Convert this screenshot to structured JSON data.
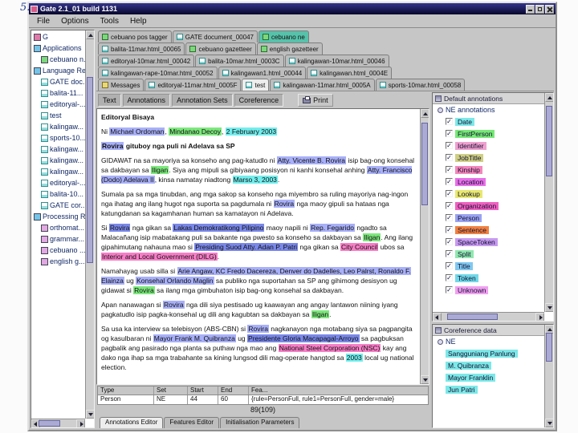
{
  "page": {
    "margin_note": "5."
  },
  "window": {
    "title": "Gate 2.1_01 build 1131",
    "menu": [
      "File",
      "Options",
      "Tools",
      "Help"
    ]
  },
  "resource_tree": {
    "items": [
      {
        "label": "G",
        "depth": 0,
        "icon": "gate"
      },
      {
        "label": "Applications",
        "depth": 0,
        "icon": "folder"
      },
      {
        "label": "cebuano n...",
        "depth": 1,
        "icon": "app"
      },
      {
        "label": "Language Re...",
        "depth": 0,
        "icon": "folder"
      },
      {
        "label": "GATE doc...",
        "depth": 1,
        "icon": "doc"
      },
      {
        "label": "balita-11...",
        "depth": 1,
        "icon": "doc"
      },
      {
        "label": "editoryal-...",
        "depth": 1,
        "icon": "doc"
      },
      {
        "label": "test",
        "depth": 1,
        "icon": "doc"
      },
      {
        "label": "kalingaw...",
        "depth": 1,
        "icon": "doc"
      },
      {
        "label": "sports-10...",
        "depth": 1,
        "icon": "doc"
      },
      {
        "label": "kalingaw...",
        "depth": 1,
        "icon": "doc"
      },
      {
        "label": "kalingaw...",
        "depth": 1,
        "icon": "doc"
      },
      {
        "label": "kalingaw...",
        "depth": 1,
        "icon": "doc"
      },
      {
        "label": "editoryal-...",
        "depth": 1,
        "icon": "doc"
      },
      {
        "label": "balita-10...",
        "depth": 1,
        "icon": "doc"
      },
      {
        "label": "GATE cor...",
        "depth": 1,
        "icon": "doc"
      },
      {
        "label": "Processing R...",
        "depth": 0,
        "icon": "folder"
      },
      {
        "label": "orthomat...",
        "depth": 1,
        "icon": "pr"
      },
      {
        "label": "grammar...",
        "depth": 1,
        "icon": "pr"
      },
      {
        "label": "cebuano ...",
        "depth": 1,
        "icon": "pr"
      },
      {
        "label": "english g...",
        "depth": 1,
        "icon": "pr"
      }
    ]
  },
  "tabs": {
    "rows": [
      [
        {
          "label": "cebuano pos tagger",
          "icon": "res",
          "state": "normal"
        },
        {
          "label": "GATE document_00047",
          "icon": "doc",
          "state": "normal"
        },
        {
          "label": "cebuano ne",
          "icon": "res",
          "state": "highlight"
        }
      ],
      [
        {
          "label": "balita-11mar.html_00065",
          "icon": "doc",
          "state": "normal"
        },
        {
          "label": "cebuano gazetteer",
          "icon": "res",
          "state": "normal"
        },
        {
          "label": "english gazetteer",
          "icon": "res",
          "state": "normal"
        }
      ],
      [
        {
          "label": "editoryal-10mar.html_00042",
          "icon": "doc",
          "state": "normal"
        },
        {
          "label": "balita-10mar.html_0003C",
          "icon": "doc",
          "state": "normal"
        },
        {
          "label": "kalingawan-10mar.html_00046",
          "icon": "doc",
          "state": "normal"
        }
      ],
      [
        {
          "label": "kalingawan-rape-10mar.html_00052",
          "icon": "doc",
          "state": "normal"
        },
        {
          "label": "kalingawan1.html_00044",
          "icon": "doc",
          "state": "normal"
        },
        {
          "label": "kalingawan.html_0004E",
          "icon": "doc",
          "state": "normal"
        }
      ],
      [
        {
          "label": "Messages",
          "icon": "msg",
          "state": "normal"
        },
        {
          "label": "editoryal-11mar.html_0005F",
          "icon": "doc",
          "state": "normal"
        },
        {
          "label": "test",
          "icon": "doc",
          "state": "selected"
        },
        {
          "label": "kalingawan-11mar.html_0005A",
          "icon": "doc",
          "state": "normal"
        },
        {
          "label": "sports-10mar.html_00058",
          "icon": "doc",
          "state": "normal"
        }
      ]
    ]
  },
  "toolbar": {
    "toggles": [
      {
        "label": "Text",
        "pressed": true
      },
      {
        "label": "Annotations",
        "pressed": true
      },
      {
        "label": "Annotation Sets",
        "pressed": true
      },
      {
        "label": "Coreference",
        "pressed": true
      }
    ],
    "print_label": "Print"
  },
  "highlight_colors": {
    "person": "#a8b0f8",
    "person_sel": "#7a88e8",
    "date": "#72eded",
    "firstperson": "#7ce87c",
    "org": "#f67ec6"
  },
  "document": {
    "paragraphs": [
      {
        "bold": true,
        "segments": [
          {
            "t": "Editoryal Bisaya"
          }
        ]
      },
      {
        "segments": [
          {
            "t": "Ni "
          },
          {
            "t": "Michael Ordoman",
            "hl": "person"
          },
          {
            "t": ", "
          },
          {
            "t": "Mindanao Decoy",
            "hl": "firstperson"
          },
          {
            "t": ", "
          },
          {
            "t": "2 February 2003",
            "hl": "date"
          }
        ]
      },
      {
        "bold": true,
        "segments": [
          {
            "t": "Rovira",
            "hl": "person"
          },
          {
            "t": " gituboy nga puli ni Adelava sa SP"
          }
        ]
      },
      {
        "segments": [
          {
            "t": "GIDAWAT na sa mayoriya sa konseho ang pag-katudlo ni "
          },
          {
            "t": "Atty. Vicente B. Rovira",
            "hl": "person"
          },
          {
            "t": " isip bag-ong konsehal sa dakbayan sa "
          },
          {
            "t": "Iligan",
            "hl": "firstperson"
          },
          {
            "t": ". Siya ang mipuli sa gibiyaang posisyon ni kanhi konsehal anhing "
          },
          {
            "t": "Atty. Francisco (Dodo) Adelava II",
            "hl": "person"
          },
          {
            "t": ", kinsa namatay niadtong "
          },
          {
            "t": "Marso 3, 2003",
            "hl": "date"
          },
          {
            "t": "."
          }
        ]
      },
      {
        "segments": [
          {
            "t": "Sumala pa sa mga tinubdan, ang mga sakop sa konseho nga miyembro sa ruling mayoriya nag-ingon nga ihatag ang ilang hugot nga suporta sa pagdumala ni "
          },
          {
            "t": "Rovira",
            "hl": "person"
          },
          {
            "t": " nga maoy gipuli sa hataas nga katungdanan sa kagamhanan human sa kamatayon ni Adelava."
          }
        ]
      },
      {
        "segments": [
          {
            "t": "Si "
          },
          {
            "t": "Rovira",
            "hl": "person_sel"
          },
          {
            "t": " nga gikan sa "
          },
          {
            "t": "Lakas Demokratikong Pilipino",
            "hl": "person_sel"
          },
          {
            "t": " maoy napili ni "
          },
          {
            "t": "Rep. Fegarido",
            "hl": "person"
          },
          {
            "t": " ngadto sa Malacañang isip mabatakang puli sa bakante nga pwesto sa konseho sa dakbayan sa "
          },
          {
            "t": "Iligan",
            "hl": "firstperson"
          },
          {
            "t": ". Ang ilang gipahimutang nahauna mao si "
          },
          {
            "t": "Presiding Suod Atty. Adan P. Patri",
            "hl": "person_sel"
          },
          {
            "t": " nga gikan sa "
          },
          {
            "t": "City Council",
            "hl": "org"
          },
          {
            "t": " ubos sa "
          },
          {
            "t": "Interior and Local Government (DILG)",
            "hl": "org"
          },
          {
            "t": "."
          }
        ]
      },
      {
        "segments": [
          {
            "t": "Namahayag usab silla si "
          },
          {
            "t": "Arie Angaw, KC Fredo Dacereza, Denver do Dadelles, Leo Palrst, Ronaldo F. Elainza",
            "hl": "person"
          },
          {
            "t": " ug "
          },
          {
            "t": "Konsehal Orlando Maglin",
            "hl": "person"
          },
          {
            "t": " sa publiko nga suportahan sa SP ang gihimong desisyon ug gidawat si "
          },
          {
            "t": "Rovira",
            "hl": "firstperson"
          },
          {
            "t": " sa ilang mga gimbuhaton isip bag-ong konsehal sa dakbayan."
          }
        ]
      },
      {
        "segments": [
          {
            "t": "Apan nanawagan si "
          },
          {
            "t": "Rovira",
            "hl": "person"
          },
          {
            "t": " nga dili siya pestisado ug kaawayan ang angay lantawon niining iyang pagkatudlo isip pagka-konsehal ug dili ang kagubtan sa dakbayan sa "
          },
          {
            "t": "Iligan",
            "hl": "firstperson"
          },
          {
            "t": "."
          }
        ]
      },
      {
        "segments": [
          {
            "t": "Sa usa ka interview sa telebisyon (ABS-CBN) si "
          },
          {
            "t": "Rovira",
            "hl": "person"
          },
          {
            "t": " nagkanayon nga motabang siya sa pagpangita og kasulbaran ni "
          },
          {
            "t": "Mayor Frank M. Quibranza",
            "hl": "person"
          },
          {
            "t": " ug "
          },
          {
            "t": "Presidente Gloria Macapagal-Arroyo",
            "hl": "person_sel"
          },
          {
            "t": " sa pagbuksan pagbalik ang pasirado nga planta sa puthaw nga mao ang "
          },
          {
            "t": "National Steel Corporation (NSC)",
            "hl": "org"
          },
          {
            "t": " kay ang dako nga ihap sa mga trabahante sa kining lungsod dili mag-operate hangtod sa "
          },
          {
            "t": "2003",
            "hl": "date"
          },
          {
            "t": " local ug national election."
          }
        ]
      }
    ]
  },
  "annotations_panel": {
    "title": "Default annotations",
    "set_name": "NE annotations",
    "types": [
      {
        "label": "Date",
        "color": "#7de8e8",
        "checked": true
      },
      {
        "label": "FirstPerson",
        "color": "#77e877",
        "checked": true
      },
      {
        "label": "Identifier",
        "color": "#f0a0d0",
        "checked": true
      },
      {
        "label": "JobTitle",
        "color": "#cfcf85",
        "checked": true
      },
      {
        "label": "Kinship",
        "color": "#f387bb",
        "checked": true
      },
      {
        "label": "Location",
        "color": "#e86ee8",
        "checked": true
      },
      {
        "label": "Lookup",
        "color": "#e8e870",
        "checked": true
      },
      {
        "label": "Organization",
        "color": "#f060c0",
        "checked": true
      },
      {
        "label": "Person",
        "color": "#9aa2f0",
        "checked": true
      },
      {
        "label": "Sentence",
        "color": "#f08040",
        "checked": true
      },
      {
        "label": "SpaceToken",
        "color": "#c79af0",
        "checked": true
      },
      {
        "label": "Split",
        "color": "#90e8b0",
        "checked": true
      },
      {
        "label": "Title",
        "color": "#80c8f0",
        "checked": true
      },
      {
        "label": "Token",
        "color": "#70d8e8",
        "checked": true
      },
      {
        "label": "Unknown",
        "color": "#f0a0f0",
        "checked": true
      }
    ]
  },
  "coreference_panel": {
    "title": "Coreference data",
    "set_name": "NE",
    "chains": [
      {
        "label": "Sangguniang Panlung",
        "color": "#7de8e8"
      },
      {
        "label": "M. Quibranza",
        "color": "#7de8e8"
      },
      {
        "label": "Mayor Franklin",
        "color": "#7de8e8"
      },
      {
        "label": "Jun Patri",
        "color": "#7de8e8"
      }
    ]
  },
  "annotation_table": {
    "columns": [
      "Type",
      "Set",
      "Start",
      "End",
      "Fea..."
    ],
    "rows": [
      [
        "Person",
        "NE",
        "44",
        "60",
        "{rule=PersonFull, rule1=PersonFull, gender=male}"
      ]
    ]
  },
  "status": {
    "counter": "89(109)"
  },
  "bottom_tabs": [
    {
      "label": "Annotations Editor",
      "selected": true
    },
    {
      "label": "Features Editor",
      "selected": false
    },
    {
      "label": "Initialisation Parameters",
      "selected": false
    }
  ]
}
